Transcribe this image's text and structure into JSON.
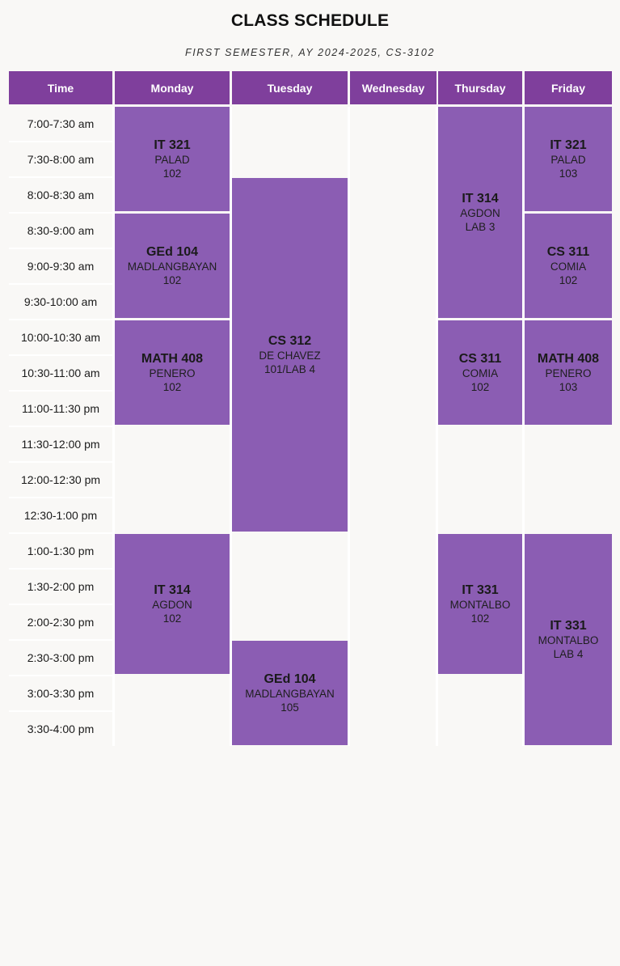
{
  "title": "CLASS SCHEDULE",
  "subtitle": "FIRST SEMESTER, AY 2024-2025, CS-3102",
  "colors": {
    "header": "#7f3f9c",
    "class_block": "#8b5db3",
    "background": "#f9f8f6",
    "gridline": "#ffffff"
  },
  "headers": [
    "Time",
    "Monday",
    "Tuesday",
    "Wednesday",
    "Thursday",
    "Friday"
  ],
  "time_slots": [
    "7:00-7:30 am",
    "7:30-8:00 am",
    "8:00-8:30 am",
    "8:30-9:00 am",
    "9:00-9:30 am",
    "9:30-10:00 am",
    "10:00-10:30 am",
    "10:30-11:00 am",
    "11:00-11:30 pm",
    "11:30-12:00 pm",
    "12:00-12:30 pm",
    "12:30-1:00 pm",
    "1:00-1:30 pm",
    "1:30-2:00 pm",
    "2:00-2:30 pm",
    "2:30-3:00 pm",
    "3:00-3:30 pm",
    "3:30-4:00 pm"
  ],
  "classes": [
    {
      "day": 1,
      "start": 0,
      "span": 3,
      "code": "IT 321",
      "instructor": "PALAD",
      "room": "102"
    },
    {
      "day": 1,
      "start": 3,
      "span": 3,
      "code": "GEd 104",
      "instructor": "MADLANGBAYAN",
      "room": "102"
    },
    {
      "day": 1,
      "start": 6,
      "span": 3,
      "code": "MATH 408",
      "instructor": "PENERO",
      "room": "102"
    },
    {
      "day": 1,
      "start": 12,
      "span": 4,
      "code": "IT 314",
      "instructor": "AGDON",
      "room": "102"
    },
    {
      "day": 2,
      "start": 2,
      "span": 10,
      "code": "CS 312",
      "instructor": "DE CHAVEZ",
      "room": "101/LAB 4"
    },
    {
      "day": 2,
      "start": 15,
      "span": 3,
      "code": "GEd 104",
      "instructor": "MADLANGBAYAN",
      "room": "105"
    },
    {
      "day": 4,
      "start": 0,
      "span": 6,
      "code": "IT 314",
      "instructor": "AGDON",
      "room": "LAB 3"
    },
    {
      "day": 4,
      "start": 6,
      "span": 3,
      "code": "CS 311",
      "instructor": "COMIA",
      "room": "102"
    },
    {
      "day": 4,
      "start": 12,
      "span": 4,
      "code": "IT 331",
      "instructor": "MONTALBO",
      "room": "102"
    },
    {
      "day": 5,
      "start": 0,
      "span": 3,
      "code": "IT 321",
      "instructor": "PALAD",
      "room": "103"
    },
    {
      "day": 5,
      "start": 3,
      "span": 3,
      "code": "CS 311",
      "instructor": "COMIA",
      "room": "102"
    },
    {
      "day": 5,
      "start": 6,
      "span": 3,
      "code": "MATH 408",
      "instructor": "PENERO",
      "room": "103"
    },
    {
      "day": 5,
      "start": 12,
      "span": 6,
      "code": "IT 331",
      "instructor": "MONTALBO",
      "room": "LAB 4"
    }
  ]
}
